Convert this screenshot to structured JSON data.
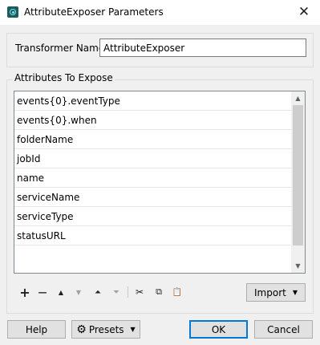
{
  "window": {
    "title": "AttributeExposer Parameters",
    "close_glyph": "✕",
    "icon": "fme-app-icon"
  },
  "name_group": {
    "label": "Transformer Name:",
    "value": "AttributeExposer"
  },
  "attributes_group": {
    "label": "Attributes To Expose",
    "items": [
      "events{0}.eventType",
      "events{0}.when",
      "folderName",
      "jobId",
      "name",
      "serviceName",
      "serviceType",
      "statusURL"
    ]
  },
  "toolbar": {
    "add": "+",
    "remove": "—",
    "move_up": "▲",
    "move_down": "▼",
    "move_top": "⏶",
    "move_bottom": "⏷",
    "cut": "✂",
    "copy": "⧉",
    "paste": "📋",
    "import_label": "Import"
  },
  "buttons": {
    "help": "Help",
    "presets": "Presets",
    "ok": "OK",
    "cancel": "Cancel"
  },
  "colors": {
    "accent": "#0078d7",
    "dialog_bg": "#f0f0f0",
    "app_icon": "#1b5c5e"
  }
}
